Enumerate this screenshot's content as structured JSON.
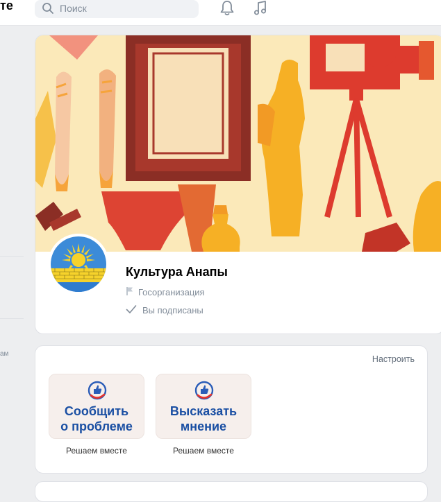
{
  "header": {
    "logo_fragment": "те",
    "search_placeholder": "Поиск",
    "bell_icon": "bell-icon",
    "music_icon": "music-note-icon"
  },
  "sidebar": {
    "fragment_text": "ам"
  },
  "group": {
    "name": "Культура Анапы",
    "type": "Госорганизация",
    "status": "Вы подписаны"
  },
  "widgets": {
    "settings_label": "Настроить",
    "items": [
      {
        "title_line1": "Сообщить",
        "title_line2": "о проблеме",
        "caption": "Решаем вместе"
      },
      {
        "title_line1": "Высказать",
        "title_line2": "мнение",
        "caption": "Решаем вместе"
      }
    ]
  },
  "colors": {
    "accent_blue": "#1a4fa3",
    "widget_bg": "#f6efec",
    "page_bg": "#edeef0",
    "cover_bg": "#fbe9b9"
  }
}
